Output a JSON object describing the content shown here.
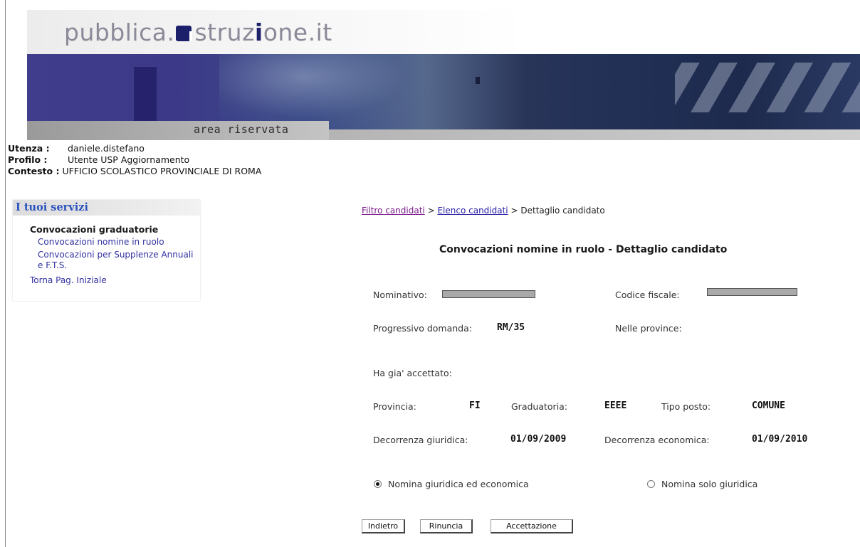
{
  "header": {
    "logo_part1": "pubblica.",
    "logo_part2": "struz",
    "logo_part3": "i",
    "logo_part4": "one",
    "logo_part5": ".it",
    "area_label": "area riservata"
  },
  "user": {
    "utenza_label": "Utenza :",
    "utenza_value": "daniele.distefano",
    "profilo_label": "Profilo :",
    "profilo_value": "Utente USP Aggiornamento",
    "contesto_label": "Contesto :",
    "contesto_value": "UFFICIO SCOLASTICO PROVINCIALE DI ROMA"
  },
  "sidebar": {
    "title": "I tuoi servizi",
    "section": "Convocazioni graduatorie",
    "items": [
      {
        "label": "Convocazioni nomine in ruolo"
      },
      {
        "label": "Convocazioni per Supplenze Annuali e F.T.S."
      }
    ],
    "home_link": "Torna Pag. Iniziale"
  },
  "breadcrumb": {
    "step1": "Filtro candidati",
    "sep": ">",
    "step2": "Elenco candidati",
    "current": "Dettaglio candidato"
  },
  "page_title": "Convocazioni nomine in ruolo - Dettaglio candidato",
  "details": {
    "nominativo_label": "Nominativo:",
    "codice_fiscale_label": "Codice fiscale:",
    "progressivo_label": "Progressivo domanda:",
    "progressivo_value": "RM/35",
    "province_label": "Nelle province:",
    "accettato_label": "Ha gia' accettato:",
    "provincia_label": "Provincia:",
    "provincia_value": "FI",
    "graduatoria_label": "Graduatoria:",
    "graduatoria_value": "EEEE",
    "tipo_posto_label": "Tipo posto:",
    "tipo_posto_value": "COMUNE",
    "decorrenza_giuridica_label": "Decorrenza giuridica:",
    "decorrenza_giuridica_value": "01/09/2009",
    "decorrenza_economica_label": "Decorrenza economica:",
    "decorrenza_economica_value": "01/09/2010"
  },
  "options": {
    "nomina_giuridica_economica": "Nomina giuridica ed economica",
    "nomina_solo_giuridica": "Nomina solo giuridica",
    "selected": "nomina_giuridica_economica"
  },
  "buttons": {
    "indietro": "Indietro",
    "rinuncia": "Rinuncia",
    "accettazione": "Accettazione"
  }
}
